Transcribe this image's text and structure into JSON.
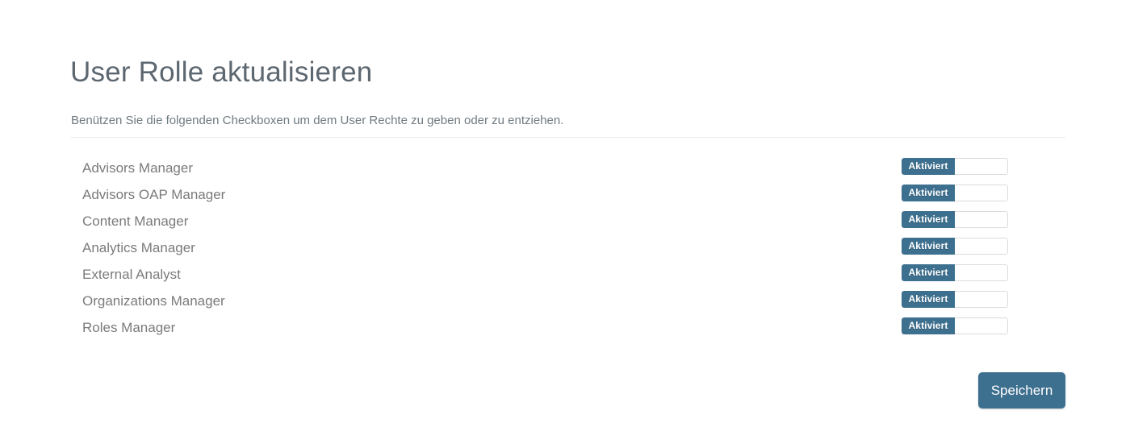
{
  "page": {
    "title": "User Rolle aktualisieren",
    "subtitle": "Benützen Sie die folgenden Checkboxen um dem User Rechte zu geben oder zu entziehen."
  },
  "colors": {
    "accent": "#3d6f8e",
    "title_text": "#5d6770",
    "body_text": "#6f7a80",
    "label_text": "#7b7b7b",
    "divider": "#ececee",
    "background": "#ffffff"
  },
  "toggle": {
    "on_label": "Aktiviert",
    "off_label": ""
  },
  "permissions": [
    {
      "label": "Advisors Manager",
      "state": "Aktiviert"
    },
    {
      "label": "Advisors OAP Manager",
      "state": "Aktiviert"
    },
    {
      "label": "Content Manager",
      "state": "Aktiviert"
    },
    {
      "label": "Analytics Manager",
      "state": "Aktiviert"
    },
    {
      "label": "External Analyst",
      "state": "Aktiviert"
    },
    {
      "label": "Organizations Manager",
      "state": "Aktiviert"
    },
    {
      "label": "Roles Manager",
      "state": "Aktiviert"
    }
  ],
  "actions": {
    "save_label": "Speichern"
  }
}
